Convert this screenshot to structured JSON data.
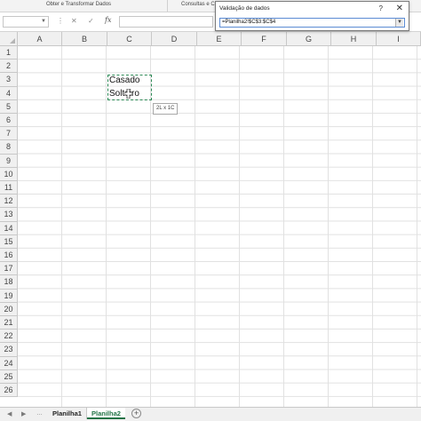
{
  "ribbon": {
    "groups": [
      "Obter e Transformar Dados",
      "Consultas e C"
    ]
  },
  "formula_bar": {
    "name_box_value": "",
    "cancel_icon": "✕",
    "enter_icon": "✓",
    "fx_label": "fx",
    "formula_value": ""
  },
  "grid": {
    "columns": [
      "A",
      "B",
      "C",
      "D",
      "E",
      "F",
      "G",
      "H",
      "I"
    ],
    "rows": [
      "1",
      "2",
      "3",
      "4",
      "5",
      "6",
      "7",
      "8",
      "9",
      "10",
      "11",
      "12",
      "13",
      "14",
      "15",
      "16",
      "17",
      "18",
      "19",
      "20",
      "21",
      "22",
      "23",
      "24",
      "25",
      "26"
    ],
    "cells": {
      "C3": "Casado",
      "C4": "Solteiro"
    },
    "selection_tooltip": "2L x 1C"
  },
  "dialog": {
    "title": "Validação de dados",
    "help_icon": "?",
    "close_icon": "✕",
    "range_value": "=Planilha2!$C$3:$C$4",
    "collapse_icon": "▼"
  },
  "sheets": {
    "tabs": [
      "Planilha1",
      "Planilha2"
    ],
    "active": "Planilha2",
    "add_label": "+"
  },
  "colors": {
    "accent": "#217346",
    "marquee": "#2e8b57"
  }
}
